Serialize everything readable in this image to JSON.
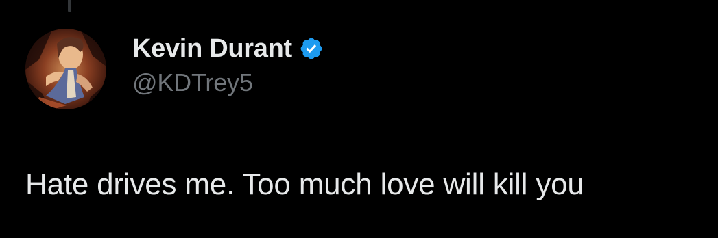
{
  "tweet": {
    "author": {
      "display_name": "Kevin Durant",
      "handle": "@KDTrey5",
      "verified": true,
      "verified_icon": "verified-badge-icon",
      "verified_color": "#1d9bf0"
    },
    "text": "Hate drives me. Too much love will kill you"
  },
  "colors": {
    "background": "#000000",
    "primary_text": "#e7e9ea",
    "secondary_text": "#71767b",
    "thread_line": "#333639"
  }
}
